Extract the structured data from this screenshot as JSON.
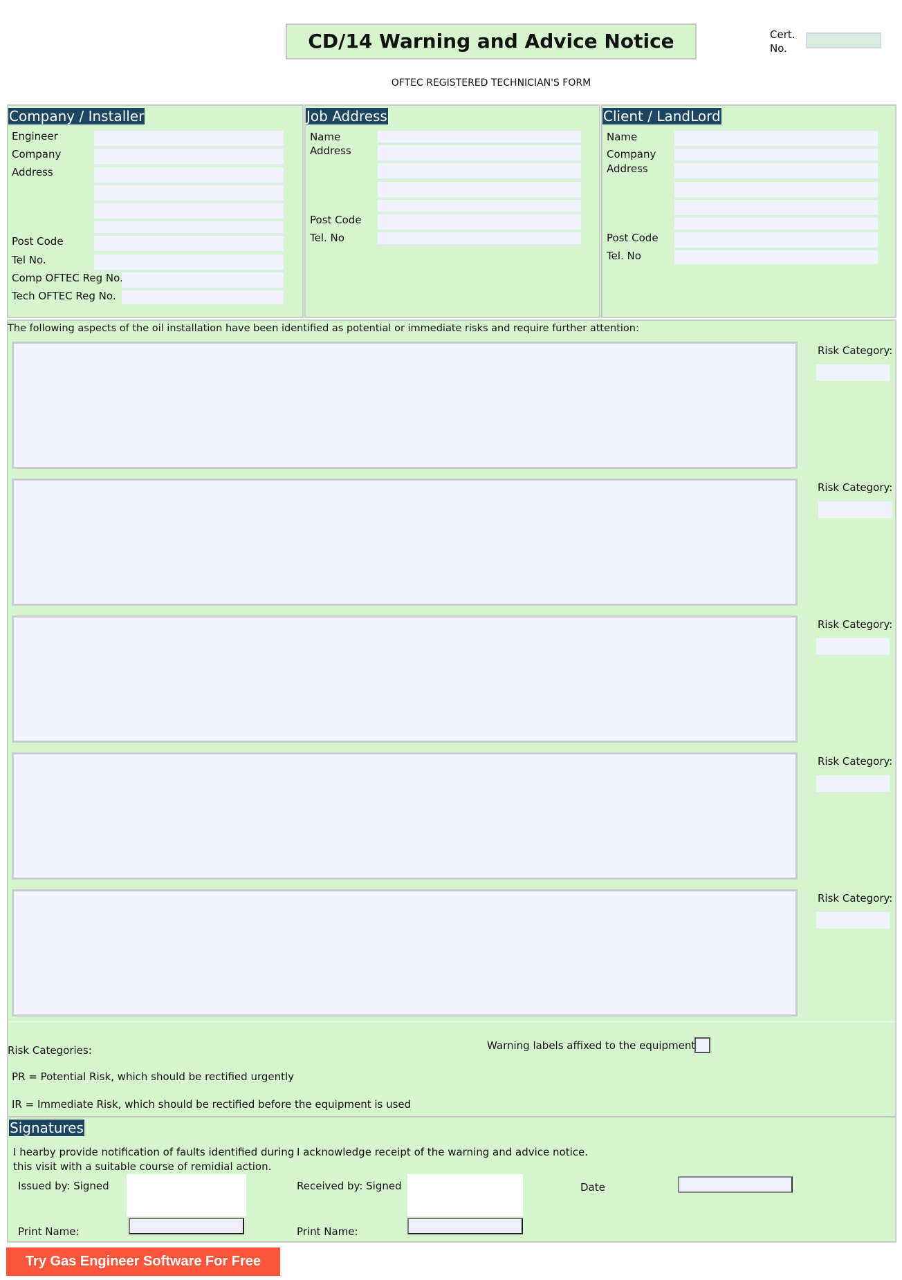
{
  "header": {
    "title": "CD/14 Warning and Advice Notice",
    "subtitle": "OFTEC REGISTERED TECHNICIAN'S FORM",
    "cert_label_1": "Cert.",
    "cert_label_2": "No.",
    "cert_value": ""
  },
  "company": {
    "heading": "Company / Installer",
    "labels": {
      "engineer": "Engineer",
      "company": "Company",
      "address": "Address",
      "post_code": "Post Code",
      "tel": "Tel No.",
      "comp_reg": "Comp OFTEC Reg No.",
      "tech_reg": "Tech OFTEC Reg No."
    }
  },
  "job": {
    "heading": "Job Address",
    "labels": {
      "name": "Name",
      "address": "Address",
      "post_code": "Post Code",
      "tel": "Tel. No"
    }
  },
  "client": {
    "heading": "Client / LandLord",
    "labels": {
      "name": "Name",
      "company": "Company",
      "address": "Address",
      "post_code": "Post Code",
      "tel": "Tel. No"
    }
  },
  "risks": {
    "intro": "The following aspects of the oil installation have been identified as potential or immediate risks and require further attention:",
    "items": [
      {
        "description": "",
        "category_label": "Risk Category:",
        "category": ""
      },
      {
        "description": "",
        "category_label": "Risk Category:",
        "category": ""
      },
      {
        "description": "",
        "category_label": "Risk Category:",
        "category": ""
      },
      {
        "description": "",
        "category_label": "Risk Category:",
        "category": ""
      },
      {
        "description": "",
        "category_label": "Risk Category:",
        "category": ""
      }
    ],
    "categories_title": "Risk Categories:",
    "pr": "PR = Potential Risk, which should be rectified urgently",
    "ir": "IR = Immediate Risk, which should be rectified before the equipment is used",
    "warning_labels": "Warning labels affixed to the equipment",
    "warning_labels_checked": false
  },
  "signatures": {
    "heading": "Signatures",
    "issuer_statement_1": "I hearby provide notification of faults identified during",
    "issuer_statement_2": "this visit with a suitable course of remidial action.",
    "receiver_statement": "I acknowledge receipt of the warning and advice notice.",
    "issued_by": "Issued by: Signed",
    "received_by": "Received by: Signed",
    "print_name": "Print Name:",
    "date": "Date"
  },
  "cta": {
    "label": "Try Gas Engineer Software For Free"
  },
  "colors": {
    "panel_green": "#d6f5cf",
    "heading_navy": "#1b4560",
    "field_bg": "#eff2fd",
    "cta_red": "#fb563c"
  }
}
